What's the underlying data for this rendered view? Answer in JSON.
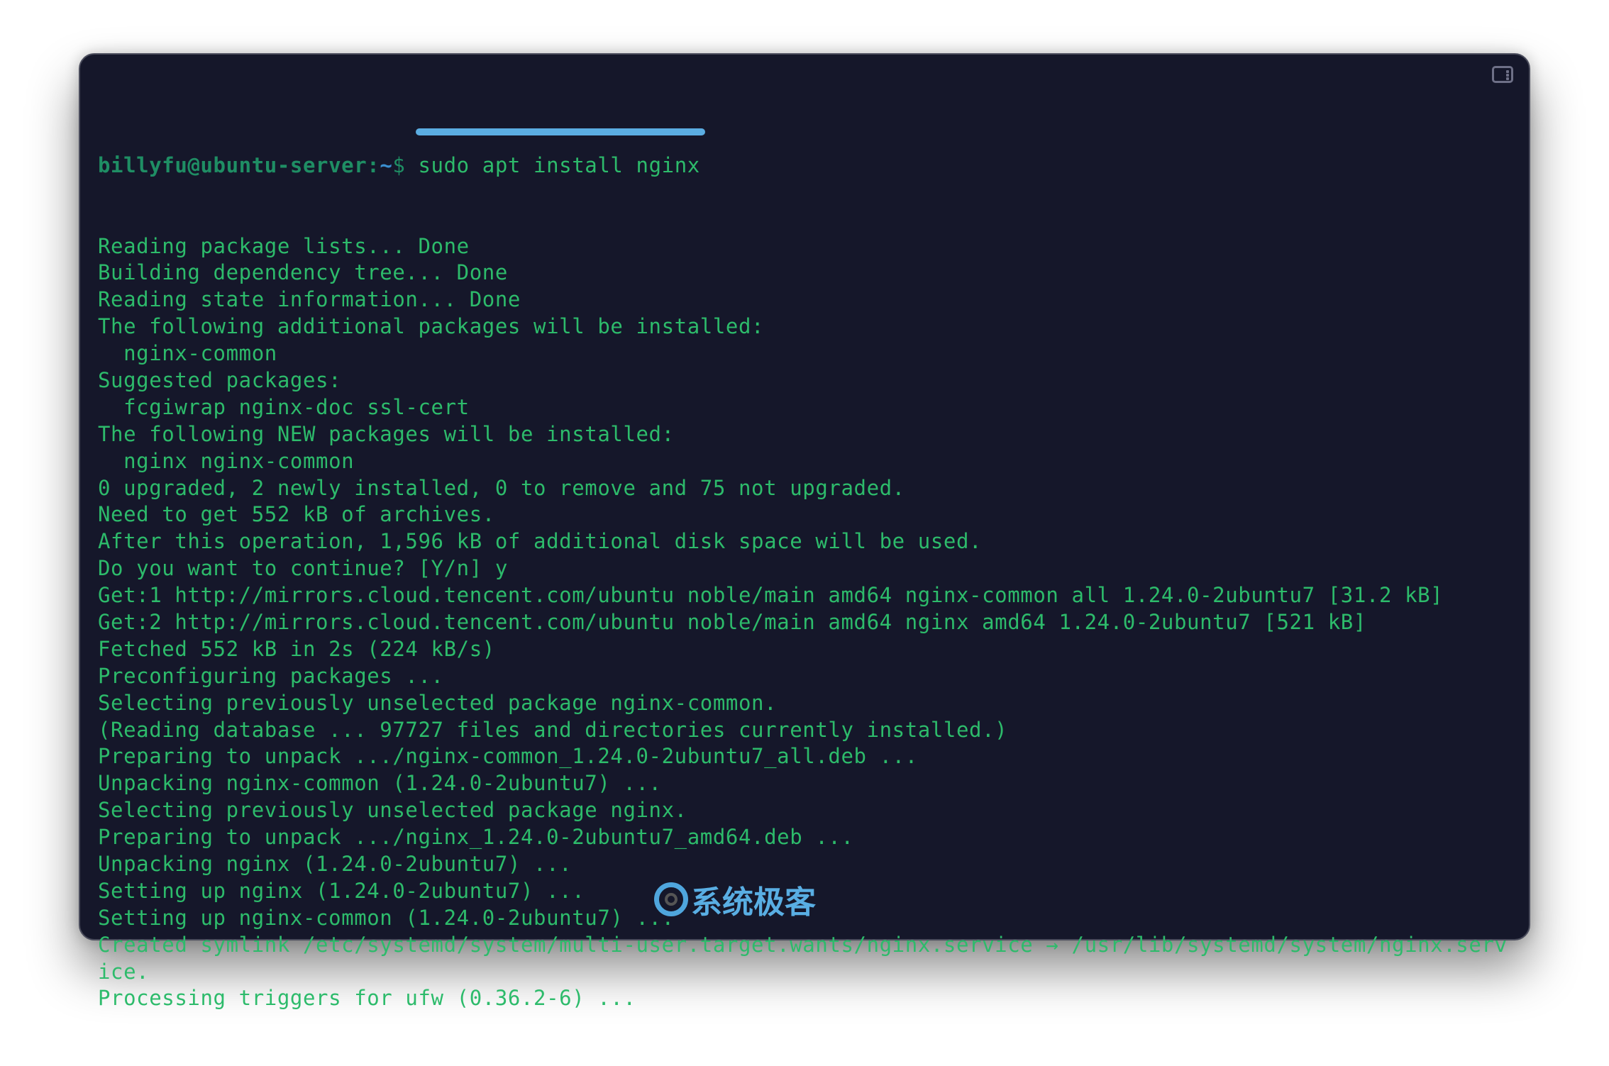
{
  "prompt": {
    "user_host": "billyfu@ubuntu-server:",
    "cwd": "~",
    "symbol": "$ ",
    "command": "sudo apt install nginx"
  },
  "output_lines": [
    "Reading package lists... Done",
    "Building dependency tree... Done",
    "Reading state information... Done",
    "The following additional packages will be installed:",
    "  nginx-common",
    "Suggested packages:",
    "  fcgiwrap nginx-doc ssl-cert",
    "The following NEW packages will be installed:",
    "  nginx nginx-common",
    "0 upgraded, 2 newly installed, 0 to remove and 75 not upgraded.",
    "Need to get 552 kB of archives.",
    "After this operation, 1,596 kB of additional disk space will be used.",
    "Do you want to continue? [Y/n] y",
    "Get:1 http://mirrors.cloud.tencent.com/ubuntu noble/main amd64 nginx-common all 1.24.0-2ubuntu7 [31.2 kB]",
    "Get:2 http://mirrors.cloud.tencent.com/ubuntu noble/main amd64 nginx amd64 1.24.0-2ubuntu7 [521 kB]",
    "Fetched 552 kB in 2s (224 kB/s)",
    "Preconfiguring packages ...",
    "Selecting previously unselected package nginx-common.",
    "(Reading database ... 97727 files and directories currently installed.)",
    "Preparing to unpack .../nginx-common_1.24.0-2ubuntu7_all.deb ...",
    "Unpacking nginx-common (1.24.0-2ubuntu7) ...",
    "Selecting previously unselected package nginx.",
    "Preparing to unpack .../nginx_1.24.0-2ubuntu7_amd64.deb ...",
    "Unpacking nginx (1.24.0-2ubuntu7) ...",
    "Setting up nginx (1.24.0-2ubuntu7) ...",
    "Setting up nginx-common (1.24.0-2ubuntu7) ...",
    "Created symlink /etc/systemd/system/multi-user.target.wants/nginx.service → /usr/lib/systemd/system/nginx.serv",
    "ice.",
    "Processing triggers for ufw (0.36.2-6) ..."
  ],
  "watermark": "系统极客",
  "icons": {
    "toggle": "sidebar-toggle-icon"
  },
  "colors": {
    "background": "#15172a",
    "text": "#2dbb6b",
    "prompt": "#1f8e64",
    "highlight": "#5badE2"
  }
}
